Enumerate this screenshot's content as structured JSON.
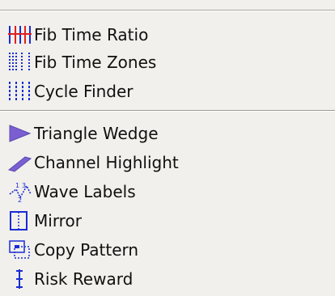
{
  "menu": {
    "group1": [
      {
        "label": "Fib Time Ratio",
        "icon": "fib-time-ratio-icon"
      },
      {
        "label": "Fib Time Zones",
        "icon": "fib-time-zones-icon"
      },
      {
        "label": "Cycle Finder",
        "icon": "cycle-finder-icon"
      }
    ],
    "group2": [
      {
        "label": "Triangle Wedge",
        "icon": "triangle-wedge-icon"
      },
      {
        "label": "Channel Highlight",
        "icon": "channel-highlight-icon"
      },
      {
        "label": "Wave Labels",
        "icon": "wave-labels-icon"
      },
      {
        "label": "Mirror",
        "icon": "mirror-icon"
      },
      {
        "label": "Copy Pattern",
        "icon": "copy-pattern-icon"
      },
      {
        "label": "Risk Reward",
        "icon": "risk-reward-icon"
      }
    ]
  },
  "colors": {
    "menu_background": "#f1f0ec",
    "icon_blue": "#1a2bd6",
    "icon_red": "#e02020",
    "icon_gray": "#6b6f7a"
  }
}
